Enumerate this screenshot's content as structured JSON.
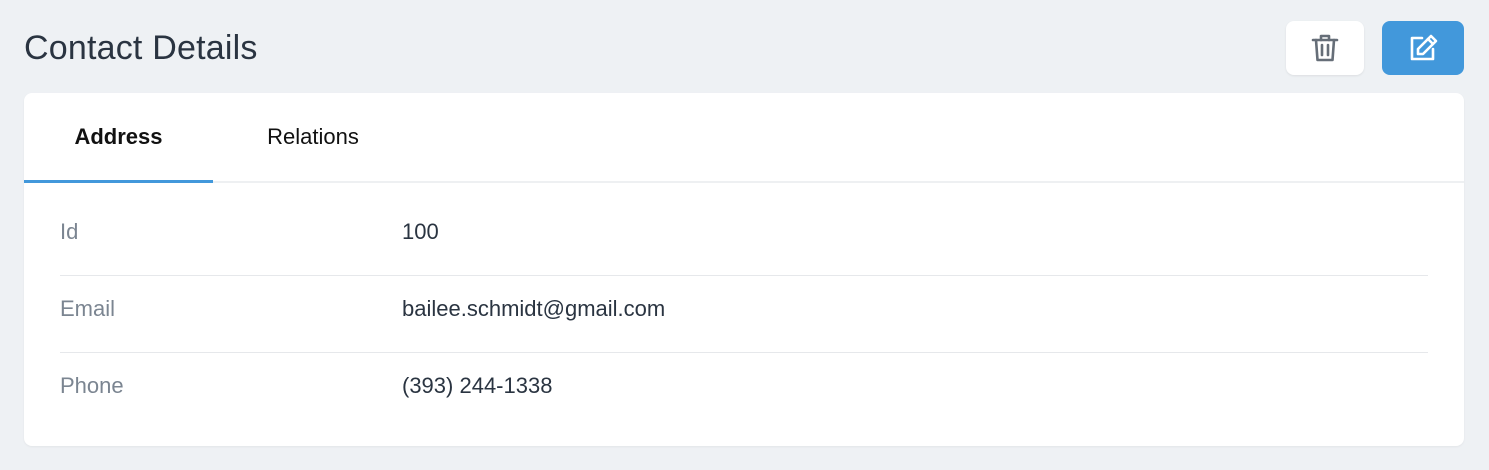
{
  "header": {
    "title": "Contact Details",
    "actions": {
      "delete_icon": "trash-icon",
      "edit_icon": "edit-icon"
    }
  },
  "tabs": [
    {
      "label": "Address",
      "active": true
    },
    {
      "label": "Relations",
      "active": false
    }
  ],
  "details": [
    {
      "label": "Id",
      "value": "100"
    },
    {
      "label": "Email",
      "value": "bailee.schmidt@gmail.com"
    },
    {
      "label": "Phone",
      "value": "(393) 244-1338"
    }
  ],
  "colors": {
    "background": "#eef1f4",
    "accent": "#4298db",
    "label": "#7b8591",
    "text": "#2a3441"
  }
}
